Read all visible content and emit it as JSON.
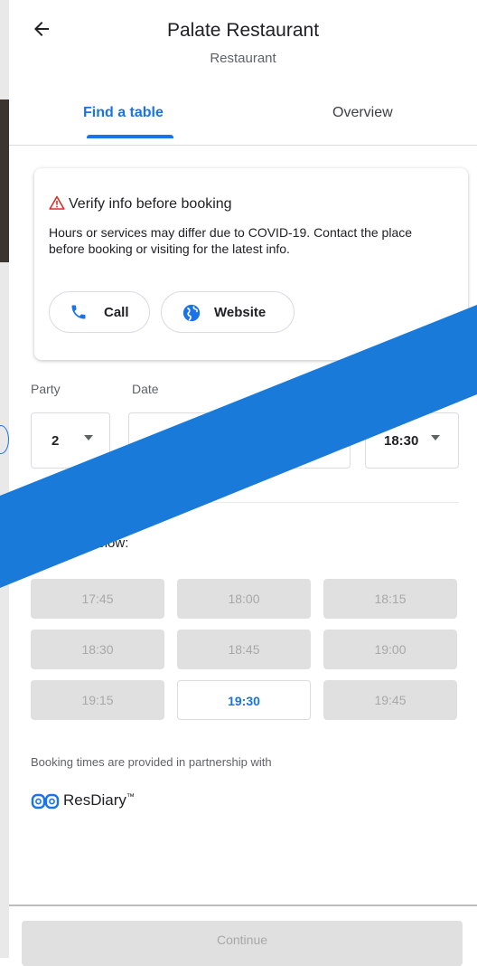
{
  "header": {
    "back_icon": "arrow-left-icon",
    "title": "Palate Restaurant",
    "subtitle": "Restaurant"
  },
  "tabs": [
    {
      "label": "Find a table",
      "active": true
    },
    {
      "label": "Overview",
      "active": false
    }
  ],
  "notice": {
    "heading": "Verify info before booking",
    "icon": "warning-triangle-icon",
    "body": "Hours or services may differ due to COVID-19. Contact the place before booking or visiting for the latest info.",
    "call_label": "Call",
    "website_label": "Website"
  },
  "form": {
    "party_label": "Party",
    "party_value": "2",
    "date_label": "Date",
    "date_value": "",
    "time_value": "18:30"
  },
  "choose_text": "se a time below:",
  "slots": [
    [
      "17:45",
      "18:00",
      "18:15"
    ],
    [
      "18:30",
      "18:45",
      "19:00"
    ],
    [
      "19:15",
      "19:30",
      "19:45"
    ]
  ],
  "selected_slot": "19:30",
  "partner_text": "Booking times are provided in partnership with",
  "partner_brand": "ResDiary",
  "partner_tm": "™",
  "continue_label": "Continue",
  "colors": {
    "accent": "#1a73e8",
    "warning": "#d93025",
    "slot_disabled": "#e0e0e0",
    "overlay_banner": "#1a7ad9"
  }
}
